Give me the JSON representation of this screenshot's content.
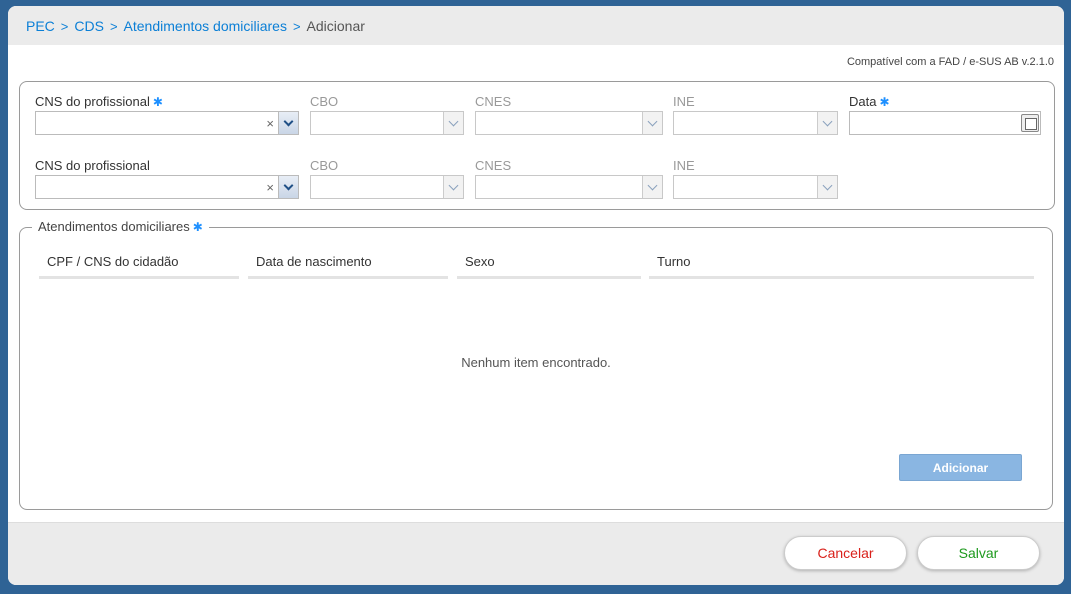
{
  "breadcrumb": {
    "items": [
      "PEC",
      "CDS",
      "Atendimentos domiciliares"
    ],
    "current": "Adicionar",
    "separator": ">"
  },
  "compat_text": "Compatível com a FAD / e-SUS AB v.2.1.0",
  "form": {
    "required_marker": "✱",
    "row1": {
      "cns_label": "CNS do profissional",
      "cbo_label": "CBO",
      "cnes_label": "CNES",
      "ine_label": "INE",
      "data_label": "Data",
      "cns_value": "",
      "data_value": ""
    },
    "row2": {
      "cns_label": "CNS do profissional",
      "cbo_label": "CBO",
      "cnes_label": "CNES",
      "ine_label": "INE",
      "cns_value": ""
    },
    "clear_glyph": "×"
  },
  "atendimentos": {
    "legend": "Atendimentos domiciliares",
    "columns": [
      "CPF / CNS do cidadão",
      "Data de nascimento",
      "Sexo",
      "Turno"
    ],
    "rows": [],
    "empty_text": "Nenhum item encontrado.",
    "add_label": "Adicionar"
  },
  "footer": {
    "cancel_label": "Cancelar",
    "save_label": "Salvar"
  },
  "colors": {
    "background": "#2f6395",
    "link": "#0b7fd6",
    "required": "#1e90ff",
    "cancel": "#d9211b",
    "save": "#1e9a1e",
    "add_button": "#8ab6e2"
  }
}
